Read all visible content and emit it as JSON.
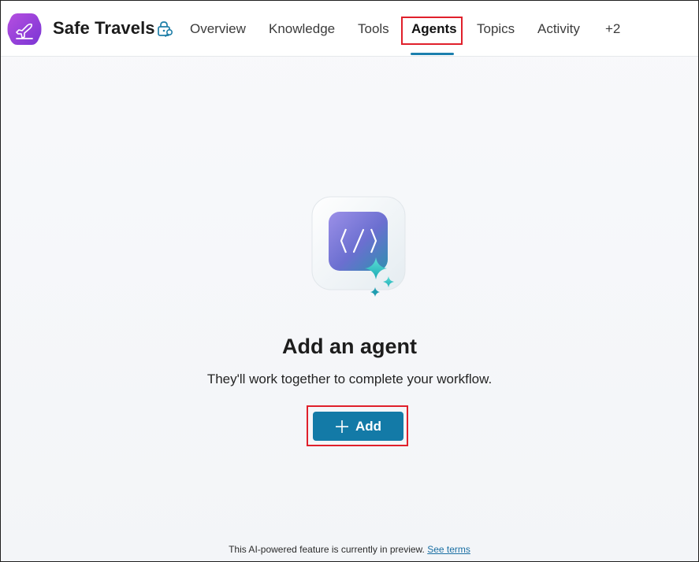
{
  "app": {
    "title": "Safe Travels",
    "logo_icon": "airplane-departure-icon",
    "brand_color": "#8f3fd6"
  },
  "nav": {
    "tabs": [
      {
        "label": "Overview"
      },
      {
        "label": "Knowledge"
      },
      {
        "label": "Tools"
      },
      {
        "label": "Agents",
        "active": true
      },
      {
        "label": "Topics"
      },
      {
        "label": "Activity"
      },
      {
        "label": "+2"
      }
    ],
    "accent_color": "#1b7fae"
  },
  "empty_state": {
    "icon": "agent-code-sparkle-icon",
    "title": "Add an agent",
    "subtitle": "They'll work together to complete your workflow.",
    "add_button_label": "Add"
  },
  "footer": {
    "note": "This AI-powered feature is currently in preview.",
    "link_label": "See terms"
  }
}
